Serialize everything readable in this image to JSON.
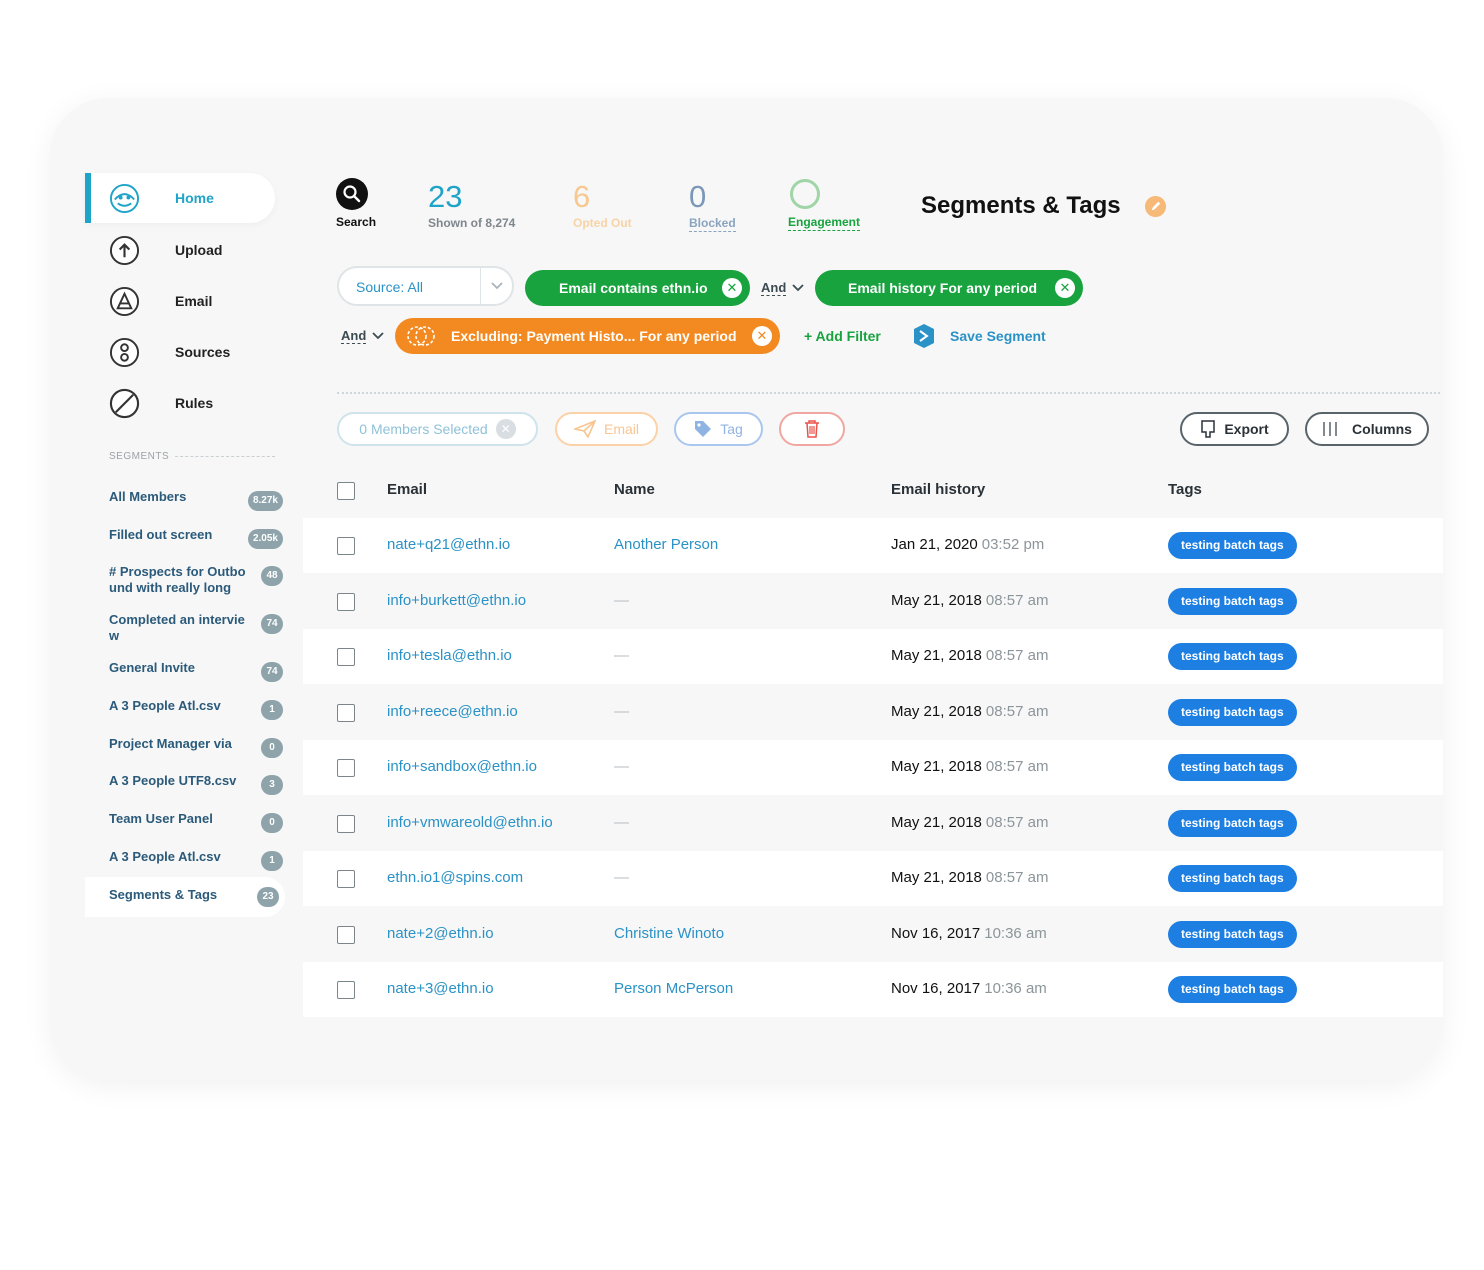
{
  "nav": [
    {
      "label": "Home",
      "icon": "home-icon"
    },
    {
      "label": "Upload",
      "icon": "upload-icon"
    },
    {
      "label": "Email",
      "icon": "email-icon"
    },
    {
      "label": "Sources",
      "icon": "sources-icon"
    },
    {
      "label": "Rules",
      "icon": "rules-icon"
    }
  ],
  "segments_heading": "SEGMENTS",
  "segments": [
    {
      "label": "All Members",
      "count": "8.27k"
    },
    {
      "label": "Filled out screen",
      "count": "2.05k"
    },
    {
      "label": "# Prospects for Outbo und with really long",
      "count": "48"
    },
    {
      "label": "Completed an intervie w",
      "count": "74"
    },
    {
      "label": "General Invite",
      "count": "74"
    },
    {
      "label": "A 3 People Atl.csv",
      "count": "1"
    },
    {
      "label": "Project Manager via",
      "count": "0"
    },
    {
      "label": "A 3 People UTF8.csv",
      "count": "3"
    },
    {
      "label": "Team User Panel",
      "count": "0"
    },
    {
      "label": "A 3 People Atl.csv",
      "count": "1"
    },
    {
      "label": "Segments & Tags",
      "count": "23"
    }
  ],
  "stats": {
    "search_label": "Search",
    "shown": {
      "value": "23",
      "label": "Shown of 8,274"
    },
    "opted_out": {
      "value": "6",
      "label": "Opted Out"
    },
    "blocked": {
      "value": "0",
      "label": "Blocked"
    },
    "engagement": {
      "label": "Engagement"
    }
  },
  "page_title": "Segments & Tags",
  "filters": {
    "source": "Source: All",
    "chip1": "Email contains ethn.io",
    "and1": "And",
    "chip2": "Email history For any period",
    "and2": "And",
    "chip3_prefix": "Excluding:",
    "chip3_text": "Payment Histo... For any period",
    "add_filter": "+ Add Filter",
    "save_segment": "Save Segment"
  },
  "actions": {
    "members_selected": "0 Members Selected",
    "email": "Email",
    "tag": "Tag",
    "export": "Export",
    "columns": "Columns"
  },
  "columns": [
    "Email",
    "Name",
    "Email history",
    "Tags"
  ],
  "rows": [
    {
      "email": "nate+q21@ethn.io",
      "name": "Another Person",
      "date": "Jan 21, 2020",
      "time": "03:52 pm",
      "tag": "testing batch tags"
    },
    {
      "email": "info+burkett@ethn.io",
      "name": "—",
      "date": "May 21, 2018",
      "time": "08:57 am",
      "tag": "testing batch tags"
    },
    {
      "email": "info+tesla@ethn.io",
      "name": "—",
      "date": "May 21, 2018",
      "time": "08:57 am",
      "tag": "testing batch tags"
    },
    {
      "email": "info+reece@ethn.io",
      "name": "—",
      "date": "May 21, 2018",
      "time": "08:57 am",
      "tag": "testing batch tags"
    },
    {
      "email": "info+sandbox@ethn.io",
      "name": "—",
      "date": "May 21, 2018",
      "time": "08:57 am",
      "tag": "testing batch tags"
    },
    {
      "email": "info+vmwareold@ethn.io",
      "name": "—",
      "date": "May 21, 2018",
      "time": "08:57 am",
      "tag": "testing batch tags"
    },
    {
      "email": "ethn.io1@spins.com",
      "name": "—",
      "date": "May 21, 2018",
      "time": "08:57 am",
      "tag": "testing batch tags"
    },
    {
      "email": "nate+2@ethn.io",
      "name": "Christine Winoto",
      "date": "Nov 16, 2017",
      "time": "10:36 am",
      "tag": "testing batch tags"
    },
    {
      "email": "nate+3@ethn.io",
      "name": "Person McPerson",
      "date": "Nov 16, 2017",
      "time": "10:36 am",
      "tag": "testing batch tags"
    }
  ],
  "colors": {
    "accent": "#1fa4c9",
    "link": "#2a92c6",
    "green": "#18a33f",
    "orange": "#f38a21",
    "tag_blue": "#1e7fe3",
    "delete_red": "#e8534a"
  }
}
